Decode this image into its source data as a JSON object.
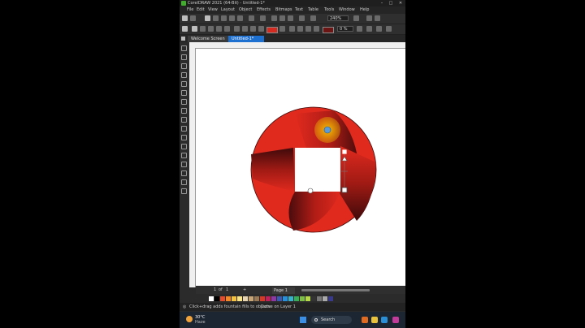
{
  "window": {
    "title": "CorelDRAW 2021 (64-Bit) - Untitled-1*"
  },
  "menu": [
    "File",
    "Edit",
    "View",
    "Layout",
    "Object",
    "Effects",
    "Bitmaps",
    "Text",
    "Table",
    "Tools",
    "Window",
    "Help"
  ],
  "toolbar": {
    "zoom": "240%",
    "transparency": "0 %"
  },
  "tabs": {
    "welcome": "Welcome Screen",
    "document": "Untitled-1*"
  },
  "pages": {
    "current": "1",
    "of_label": "of",
    "total": "1",
    "page_tab": "Page 1"
  },
  "status": {
    "hint": "Click+drag adds fountain fills to objects",
    "object_info": "Curve on Layer 1"
  },
  "taskbar": {
    "temperature": "30°C",
    "condition": "Haze",
    "search_label": "Search"
  },
  "colors": {
    "accent_blue": "#1d6fd0",
    "logo_red": "#d42a1f",
    "logo_dark": "#6b1515",
    "highlight_yellow": "#f5c400"
  },
  "palette": [
    "#ffffff",
    "#000000",
    "#e84b2a",
    "#f08a2b",
    "#f6c23a",
    "#f7e38a",
    "#e8d5b0",
    "#c7a77a",
    "#9a7a55",
    "#d33a2a",
    "#c21f5b",
    "#8a3aa0",
    "#3a59b5",
    "#2a8fd6",
    "#37b3c9",
    "#3caa5a",
    "#7bc043",
    "#b6d84a",
    "#333333",
    "#777777",
    "#aaaaaa",
    "#3a3a8a"
  ]
}
